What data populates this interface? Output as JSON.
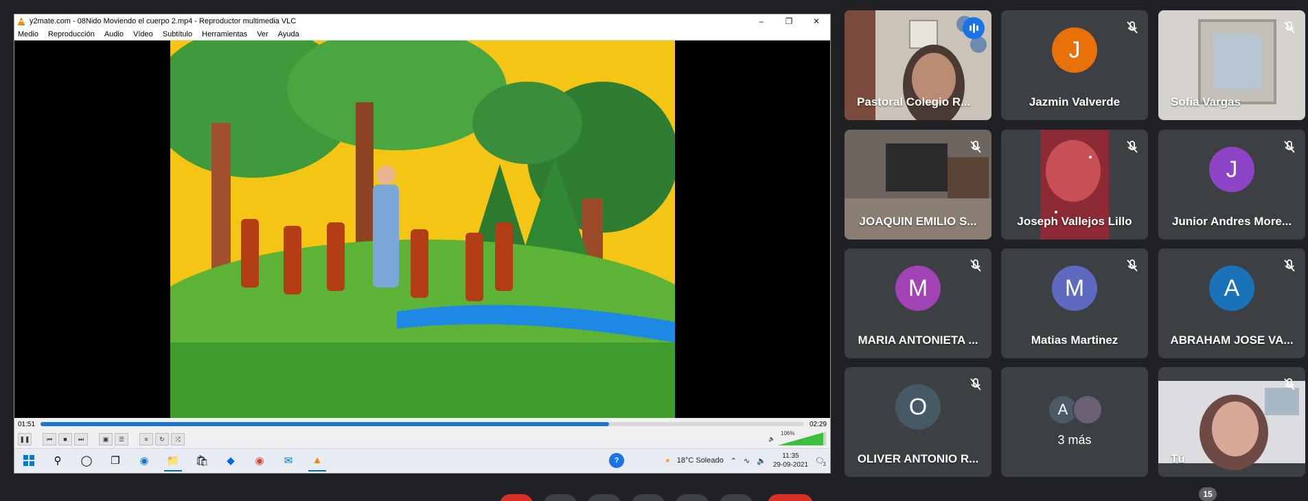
{
  "vlc": {
    "title": "y2mate.com - 08Nido Moviendo el cuerpo 2.mp4 - Reproductor multimedia VLC",
    "menu": [
      "Medio",
      "Reproducción",
      "Audio",
      "Vídeo",
      "Subtítulo",
      "Herramientas",
      "Ver",
      "Ayuda"
    ],
    "elapsed": "01:51",
    "total": "02:29",
    "progress_fraction": 0.745,
    "volume_label": "106%"
  },
  "taskbar": {
    "weather": "18°C  Soleado",
    "time": "11:35",
    "date": "29-09-2021",
    "notifications": "3"
  },
  "meet": {
    "participants": [
      {
        "name": "Pastoral Colegio R...",
        "type": "video",
        "speaking": true
      },
      {
        "name": "Jazmin Valverde",
        "initial": "J",
        "color": "#e8710a"
      },
      {
        "name": "Sofia Vargas",
        "type": "video"
      },
      {
        "name": "JOAQUIN EMILIO S...",
        "type": "video"
      },
      {
        "name": "Joseph Vallejos Lillo",
        "type": "video"
      },
      {
        "name": "Junior Andres More...",
        "initial": "J",
        "color": "#8e44c6"
      },
      {
        "name": "MARIA ANTONIETA ...",
        "initial": "M",
        "color": "#a142b5"
      },
      {
        "name": "Matias Martinez",
        "initial": "M",
        "color": "#5c6bc0"
      },
      {
        "name": "ABRAHAM JOSE VA...",
        "initial": "A",
        "color": "#1a73b8"
      },
      {
        "name": "OLIVER ANTONIO R...",
        "initial": "O",
        "color": "#455a64"
      },
      {
        "name": "3 más",
        "mini_initial": "A"
      },
      {
        "name": "Tú",
        "type": "video"
      }
    ],
    "participant_count": "15"
  }
}
